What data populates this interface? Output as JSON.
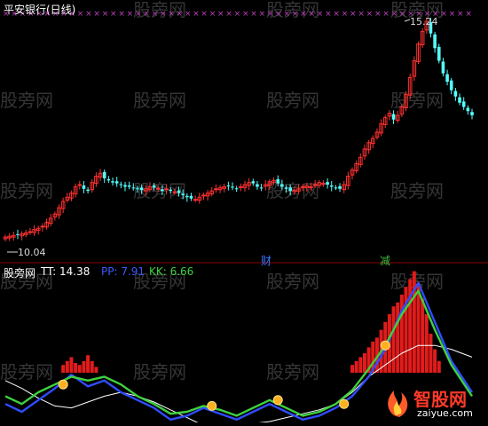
{
  "chart_data": [
    {
      "type": "candlestick",
      "title": "平安银行(日线)",
      "high_label": "15.24",
      "low_label": "10.04",
      "markers": [
        {
          "text": "财",
          "color": "#3b74ff"
        },
        {
          "text": "减",
          "color": "#3fbf3f"
        }
      ],
      "x": [
        0,
        1,
        2,
        3,
        4,
        5,
        6,
        7,
        8,
        9,
        10,
        11,
        12,
        13,
        14,
        15,
        16,
        17,
        18,
        19,
        20,
        21,
        22,
        23,
        24,
        25,
        26,
        27,
        28,
        29,
        30,
        31,
        32,
        33,
        34,
        35,
        36,
        37,
        38,
        39,
        40,
        41,
        42,
        43,
        44,
        45,
        46,
        47,
        48,
        49,
        50,
        51,
        52,
        53,
        54,
        55,
        56,
        57,
        58,
        59,
        60,
        61,
        62,
        63,
        64,
        65,
        66,
        67,
        68,
        69,
        70,
        71,
        72,
        73,
        74,
        75,
        76,
        77,
        78,
        79,
        80,
        81,
        82,
        83,
        84,
        85,
        86,
        87,
        88,
        89,
        90,
        91,
        92,
        93,
        94,
        95,
        96,
        97,
        98,
        99,
        100,
        101,
        102,
        103,
        104,
        105,
        106,
        107,
        108,
        109,
        110,
        111,
        112,
        113
      ],
      "close": [
        10.1,
        10.12,
        10.14,
        10.15,
        10.18,
        10.2,
        10.23,
        10.28,
        10.31,
        10.36,
        10.45,
        10.55,
        10.65,
        10.8,
        10.95,
        11.05,
        11.15,
        11.3,
        11.35,
        11.25,
        11.2,
        11.4,
        11.55,
        11.62,
        11.5,
        11.45,
        11.4,
        11.38,
        11.36,
        11.3,
        11.3,
        11.28,
        11.25,
        11.22,
        11.25,
        11.3,
        11.28,
        11.26,
        11.2,
        11.25,
        11.2,
        11.18,
        11.15,
        11.1,
        11.05,
        11.02,
        11.0,
        11.05,
        11.1,
        11.15,
        11.2,
        11.25,
        11.28,
        11.3,
        11.32,
        11.28,
        11.25,
        11.3,
        11.35,
        11.4,
        11.38,
        11.3,
        11.28,
        11.35,
        11.42,
        11.45,
        11.38,
        11.3,
        11.25,
        11.2,
        11.22,
        11.25,
        11.3,
        11.32,
        11.3,
        11.35,
        11.4,
        11.38,
        11.35,
        11.3,
        11.28,
        11.25,
        11.35,
        11.55,
        11.7,
        11.85,
        12.0,
        12.2,
        12.35,
        12.45,
        12.6,
        12.8,
        12.95,
        13.05,
        12.9,
        13.0,
        13.2,
        13.5,
        13.9,
        14.3,
        14.7,
        15.0,
        15.24,
        14.95,
        14.6,
        14.3,
        14.0,
        13.8,
        13.6,
        13.45,
        13.3,
        13.2,
        13.1,
        13.0
      ],
      "low_price_axis": 10.04,
      "high_price_axis": 15.24
    },
    {
      "type": "line",
      "title": "股旁网",
      "series": [
        {
          "name": "TT",
          "value_label": "TT: 14.38",
          "color": "#ffffff"
        },
        {
          "name": "PP",
          "value_label": "PP: 7.91",
          "color": "#3b5bff"
        },
        {
          "name": "KK",
          "value_label": "KK: 6.66",
          "color": "#3fd13f"
        }
      ],
      "x": [
        0,
        4,
        8,
        12,
        16,
        20,
        24,
        28,
        32,
        36,
        40,
        44,
        48,
        52,
        56,
        60,
        64,
        68,
        72,
        76,
        80,
        84,
        88,
        92,
        96,
        100,
        104,
        108,
        113
      ],
      "tt": [
        -4,
        -8,
        -13,
        -17,
        -18,
        -15,
        -12,
        -10,
        -12,
        -15,
        -19,
        -23,
        -27,
        -28,
        -27,
        -26,
        -25,
        -23,
        -21,
        -19,
        -16,
        -10,
        -2,
        4,
        10,
        14,
        14,
        12,
        8
      ],
      "pp": [
        -16,
        -20,
        -14,
        -8,
        -1,
        -7,
        -4,
        -10,
        -14,
        -18,
        -24,
        -22,
        -18,
        -21,
        -24,
        -20,
        -16,
        -20,
        -24,
        -22,
        -18,
        -12,
        -2,
        12,
        32,
        46,
        26,
        6,
        -10
      ],
      "kk": [
        -12,
        -16,
        -10,
        -6,
        -2,
        -4,
        -2,
        -6,
        -12,
        -16,
        -21,
        -20,
        -17,
        -19,
        -22,
        -18,
        -14,
        -18,
        -22,
        -20,
        -16,
        -9,
        2,
        14,
        30,
        42,
        22,
        4,
        -12
      ],
      "bars": [
        0,
        0,
        0,
        0,
        0,
        0,
        0,
        0,
        0,
        0,
        0,
        0,
        0,
        0,
        4,
        6,
        8,
        5,
        4,
        6,
        9,
        6,
        3,
        0,
        0,
        0,
        0,
        0,
        0,
        0,
        0,
        0,
        0,
        0,
        0,
        0,
        0,
        0,
        0,
        0,
        0,
        0,
        0,
        0,
        0,
        0,
        0,
        0,
        0,
        0,
        0,
        0,
        0,
        0,
        0,
        0,
        0,
        0,
        0,
        0,
        0,
        0,
        0,
        0,
        0,
        0,
        0,
        0,
        0,
        0,
        0,
        0,
        0,
        0,
        0,
        0,
        0,
        0,
        0,
        0,
        0,
        0,
        0,
        0,
        4,
        6,
        8,
        10,
        13,
        16,
        18,
        22,
        26,
        30,
        34,
        36,
        40,
        44,
        48,
        52,
        46,
        38,
        30,
        20,
        12,
        6,
        0,
        0,
        0,
        0,
        0,
        0,
        0,
        0
      ],
      "signal_points": [
        14,
        50,
        66,
        82,
        92
      ]
    }
  ],
  "watermark": "股旁网",
  "brand": {
    "name": "智股网",
    "url": "zaiyue.com"
  }
}
